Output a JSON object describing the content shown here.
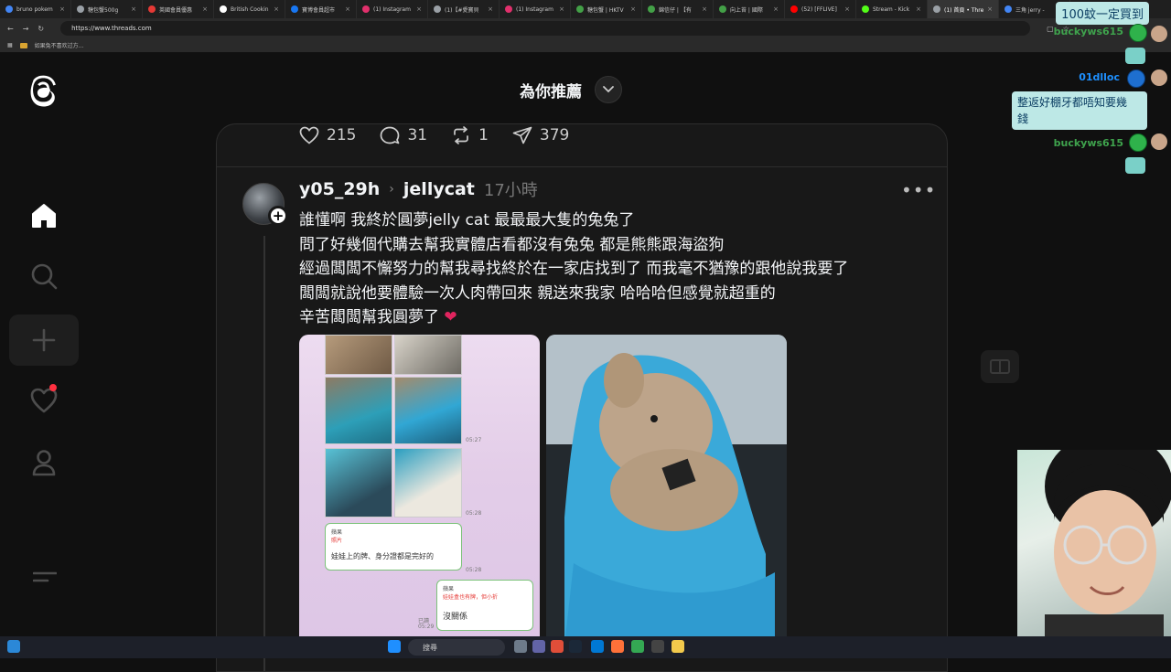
{
  "browser": {
    "tabs": [
      {
        "label": "bruno pokem",
        "color": "#4285f4"
      },
      {
        "label": "糖包蟹500g",
        "color": "#9aa0a6"
      },
      {
        "label": "英國會員優惠",
        "color": "#e53935"
      },
      {
        "label": "British Cookin",
        "color": "#ffffff"
      },
      {
        "label": "寶博會員超市",
        "color": "#1877f2"
      },
      {
        "label": "(1) Instagram",
        "color": "#e1306c"
      },
      {
        "label": "(1)【#愛寶貝",
        "color": "#9aa0a6"
      },
      {
        "label": "(1) Instagram",
        "color": "#e1306c"
      },
      {
        "label": "糖包蟹 | HKTV",
        "color": "#43a047"
      },
      {
        "label": "錦信仔 | 【有",
        "color": "#43a047"
      },
      {
        "label": "向上苔 | 國際",
        "color": "#43a047"
      },
      {
        "label": "(52) [FFLIVE]",
        "color": "#ff0000"
      },
      {
        "label": "Stream - Kick",
        "color": "#53fc18"
      },
      {
        "label": "(1) 首頁 • Thre",
        "color": "#9aa0a6"
      },
      {
        "label": "三角 jerry -",
        "color": "#4285f4"
      }
    ],
    "active_tab_index": 13,
    "url": "https://www.threads.com",
    "bookmark_label": "如果兔不喜欢过方..."
  },
  "header": {
    "title": "為你推薦"
  },
  "prev_post_actions": {
    "likes": "215",
    "replies": "31",
    "reposts": "1",
    "shares": "379"
  },
  "post": {
    "username": "y05_29h",
    "topic": "jellycat",
    "time": "17小時",
    "lines": [
      "誰懂啊 我終於圓夢jelly cat 最最最大隻的兔兔了",
      "問了好幾個代購去幫我實體店看都沒有兔兔 都是熊熊跟海盜狗",
      "經過闆闆不懈努力的幫我尋找終於在一家店找到了 而我毫不猶豫的跟他說我要了",
      "闆闆就說他要體驗一次人肉帶回來 親送來我家 哈哈哈但感覺就超重的",
      "辛苦闆闆幫我圓夢了"
    ],
    "heart_emoji": "❤",
    "screenshot": {
      "msg1_name": "蘋果",
      "msg1_sub": "照片",
      "msg1_text": "娃娃上的牌、身分證都是完好的",
      "msg2_name": "蘋果",
      "msg2_sub": "娃娃盒也有牌，但小折",
      "msg2_text": "沒關係",
      "time1": "05:27",
      "time2": "05:28",
      "time3": "05:28",
      "time4": "05:29",
      "read": "已讀"
    }
  },
  "chat_overlay": {
    "msg1": "100蚊一定買到",
    "user1": "buckyws615",
    "user2": "01dlloc",
    "msg2_line1": "整返好棚牙都唔知要幾",
    "msg2_line2": "錢",
    "user3": "buckyws615",
    "user_color_1": "#3fa34d",
    "user_color_2": "#1e90ff"
  },
  "taskbar": {
    "search_label": "搜尋"
  },
  "colors": {
    "background": "#101010",
    "card": "#181818",
    "accent_red": "#ff3040"
  }
}
